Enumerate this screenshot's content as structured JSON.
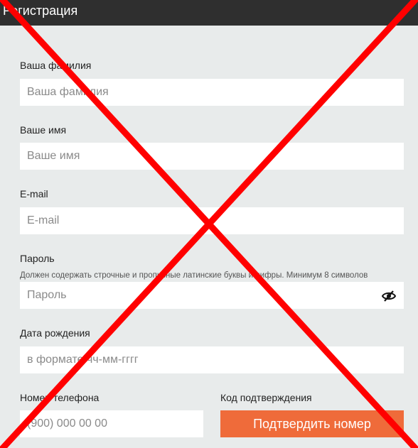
{
  "header": {
    "title": "Регистрация"
  },
  "form": {
    "last_name": {
      "label": "Ваша фамилия",
      "placeholder": "Ваша фамилия"
    },
    "first_name": {
      "label": "Ваше имя",
      "placeholder": "Ваше имя"
    },
    "email": {
      "label": "E-mail",
      "placeholder": "E-mail"
    },
    "password": {
      "label": "Пароль",
      "hint": "Должен содержать строчные и прописные латинские буквы и цифры. Минимум 8 символов",
      "placeholder": "Пароль"
    },
    "birth_date": {
      "label": "Дата рождения",
      "placeholder": "в формате чч-мм-гггг"
    },
    "phone": {
      "label": "Номер телефона",
      "placeholder": "(900) 000 00 00"
    },
    "code": {
      "label": "Код подтверждения",
      "button_label": "Подтвердить номер"
    }
  },
  "colors": {
    "header_bg": "#2f2f2f",
    "page_bg": "#e8ebeb",
    "accent": "#ef6b3a",
    "cross": "#ff0000"
  },
  "icons": {
    "password_toggle": "eye-slash-icon"
  }
}
